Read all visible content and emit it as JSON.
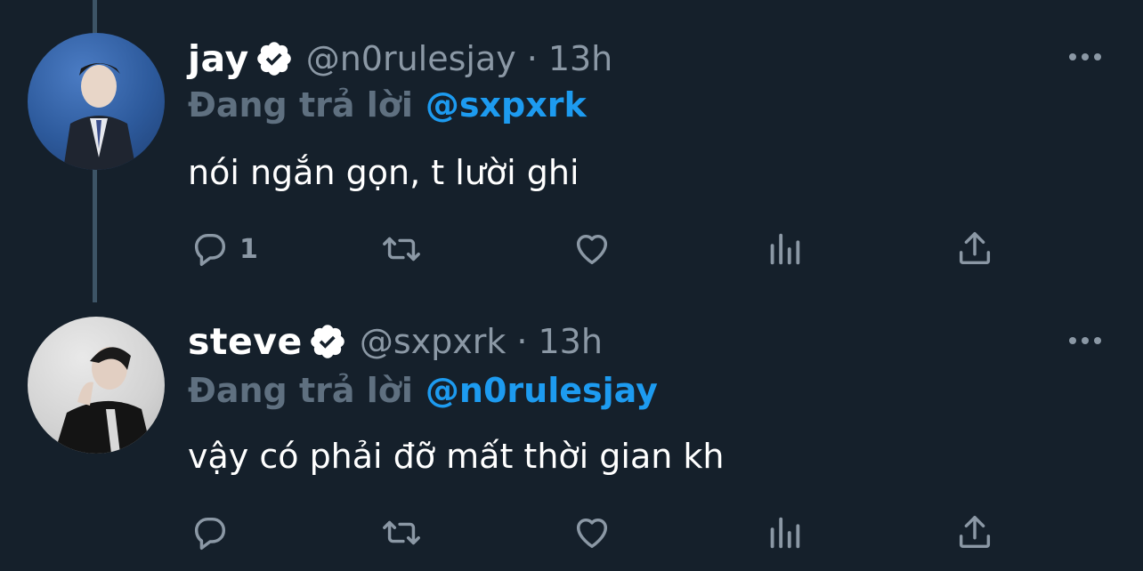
{
  "colors": {
    "background": "#15202b",
    "accent": "#1d9bf0",
    "muted": "#8b98a5",
    "text": "#ffffff"
  },
  "tweets": [
    {
      "name": "jay",
      "handle": "@n0rulesjay",
      "separator": "·",
      "time": "13h",
      "reply_prefix": "Đang trả lời",
      "reply_to": "@sxpxrk",
      "text": "nói ngắn gọn, t lười ghi",
      "reply_count": "1",
      "verified": true
    },
    {
      "name": "steve",
      "handle": "@sxpxrk",
      "separator": "·",
      "time": "13h",
      "reply_prefix": "Đang trả lời",
      "reply_to": "@n0rulesjay",
      "text": "vậy có phải đỡ mất thời gian kh",
      "reply_count": "",
      "verified": true
    }
  ],
  "icons": {
    "verified": "verified-badge-icon",
    "more": "more-options-icon",
    "reply": "reply-icon",
    "retweet": "retweet-icon",
    "like": "heart-icon",
    "views": "views-bar-chart-icon",
    "share": "share-icon"
  }
}
